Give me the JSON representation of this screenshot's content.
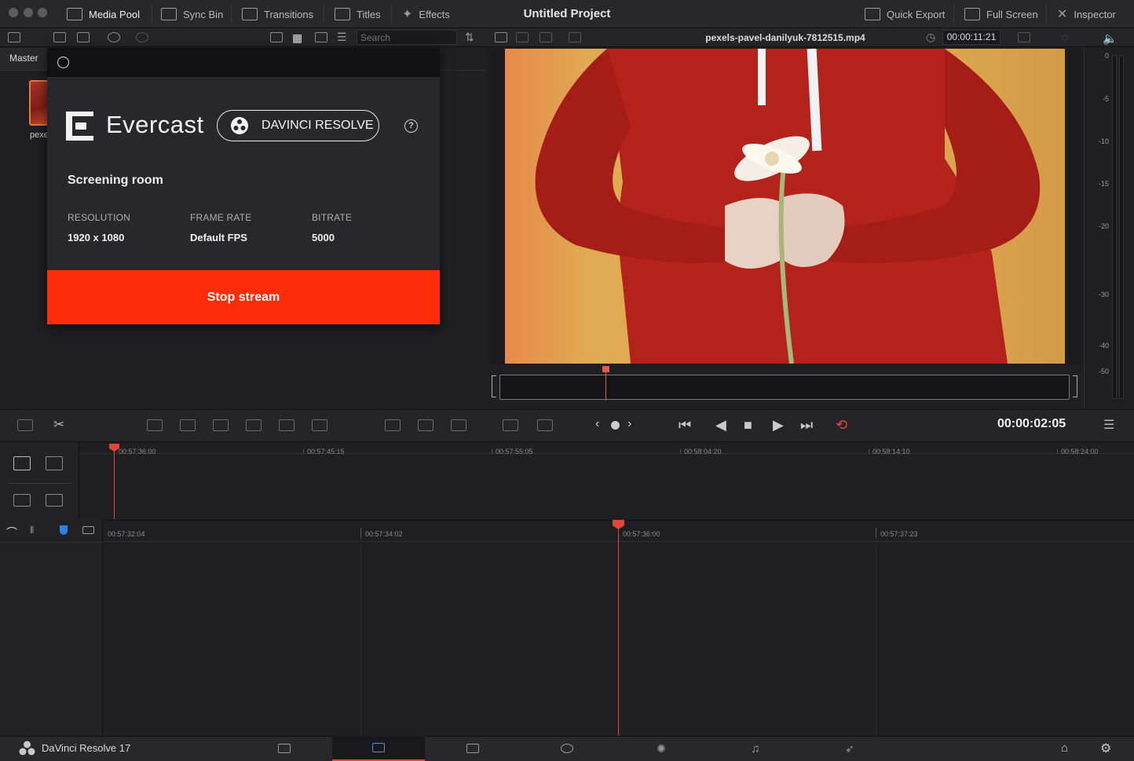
{
  "window": {
    "project_title": "Untitled Project"
  },
  "toolbar": {
    "left": [
      {
        "label": "Media Pool",
        "icon": "media-pool-icon"
      },
      {
        "label": "Sync Bin",
        "icon": "sync-bin-icon"
      },
      {
        "label": "Transitions",
        "icon": "transitions-icon"
      },
      {
        "label": "Titles",
        "icon": "titles-icon"
      },
      {
        "label": "Effects",
        "icon": "effects-icon"
      }
    ],
    "right": [
      {
        "label": "Quick Export",
        "icon": "export-icon"
      },
      {
        "label": "Full Screen",
        "icon": "fullscreen-icon"
      },
      {
        "label": "Inspector",
        "icon": "inspector-icon"
      }
    ]
  },
  "media_pool": {
    "bin_label": "Master",
    "search_placeholder": "Search",
    "clip_label_truncated": "pexe"
  },
  "viewer": {
    "clip_name": "pexels-pavel-danilyuk-7812515.mp4",
    "source_timecode": "00:00:11:21",
    "current_timecode": "00:00:02:05"
  },
  "audio_meter": {
    "ticks": [
      "0",
      "-5",
      "-10",
      "-15",
      "-20",
      "-30",
      "-40",
      "-50"
    ]
  },
  "timeline": {
    "upper_ruler": [
      "00:57:36:00",
      "00:57:45:15",
      "00:57:55:05",
      "00:58:04:20",
      "00:58:14:10",
      "00:58:24:00"
    ],
    "lower_ruler": [
      "00:57:32:04",
      "00:57:34:02",
      "00:57:36:00",
      "00:57:37:23"
    ]
  },
  "evercast": {
    "brand": "Evercast",
    "pill_label": "DAVINCI RESOLVE",
    "help_glyph": "?",
    "room_title": "Screening room",
    "stats": [
      {
        "key": "RESOLUTION",
        "value": "1920 x 1080"
      },
      {
        "key": "FRAME RATE",
        "value": "Default FPS"
      },
      {
        "key": "BITRATE",
        "value": "5000"
      }
    ],
    "stop_label": "Stop stream",
    "accent_color": "#fe2c08"
  },
  "bottombar": {
    "app_name": "DaVinci Resolve 17",
    "pages": [
      "media-page-icon",
      "cut-page-icon",
      "edit-page-icon",
      "fusion-page-icon",
      "color-page-icon",
      "fairlight-page-icon",
      "deliver-page-icon"
    ],
    "active_page": "cut-page-icon"
  }
}
